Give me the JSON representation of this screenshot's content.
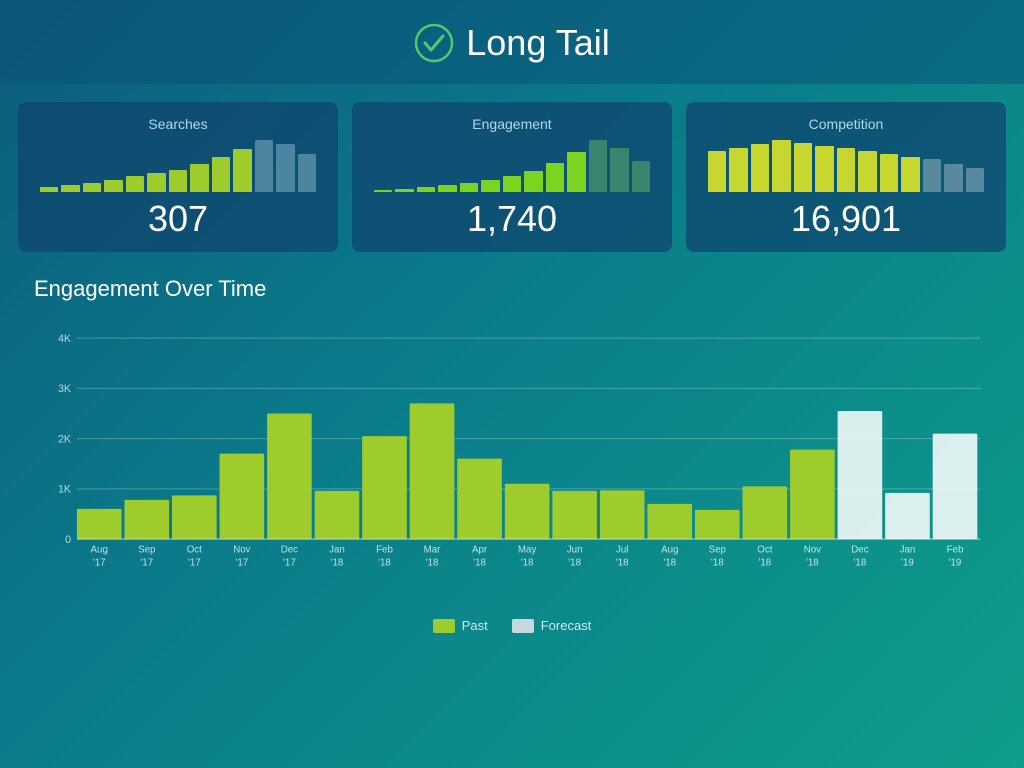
{
  "header": {
    "title": "Long Tail",
    "check_icon_label": "check-circle-icon"
  },
  "cards": [
    {
      "id": "searches",
      "label": "Searches",
      "value": "307",
      "bars": [
        3,
        4,
        5,
        7,
        9,
        11,
        13,
        16,
        20,
        25,
        30,
        28,
        22
      ],
      "bar_color_main": "#9dcc2c",
      "bar_color_forecast": "#6a9bb5"
    },
    {
      "id": "engagement",
      "label": "Engagement",
      "value": "1,740",
      "bars": [
        2,
        3,
        5,
        7,
        9,
        12,
        15,
        20,
        28,
        38,
        50,
        42,
        30
      ],
      "bar_color_main": "#7dd420",
      "bar_color_forecast": "#4e9b6a"
    },
    {
      "id": "competition",
      "label": "Competition",
      "value": "16,901",
      "bars": [
        30,
        32,
        35,
        38,
        36,
        34,
        32,
        30,
        28,
        26,
        24,
        20,
        18
      ],
      "bar_color_main": "#c8d630",
      "bar_color_forecast": "#7a9fb0"
    }
  ],
  "chart": {
    "title": "Engagement Over Time",
    "y_labels": [
      "4K",
      "3K",
      "2K",
      "1K",
      "0"
    ],
    "x_labels": [
      "Aug\n'17",
      "Sep\n'17",
      "Oct\n'17",
      "Nov\n'17",
      "Dec\n'17",
      "Jan\n'18",
      "Feb\n'18",
      "Mar\n'18",
      "Apr\n'18",
      "May\n'18",
      "Jun\n'18",
      "Jul\n'18",
      "Aug\n'18",
      "Sep\n'18",
      "Oct\n'18",
      "Nov\n'18",
      "Dec\n'18",
      "Jan\n'19",
      "Feb\n'19"
    ],
    "bars": [
      {
        "month": "Aug '17",
        "value": 600,
        "forecast": false
      },
      {
        "month": "Sep '17",
        "value": 780,
        "forecast": false
      },
      {
        "month": "Oct '17",
        "value": 870,
        "forecast": false
      },
      {
        "month": "Nov '17",
        "value": 1700,
        "forecast": false
      },
      {
        "month": "Dec '17",
        "value": 2500,
        "forecast": false
      },
      {
        "month": "Jan '18",
        "value": 960,
        "forecast": false
      },
      {
        "month": "Feb '18",
        "value": 2050,
        "forecast": false
      },
      {
        "month": "Mar '18",
        "value": 2700,
        "forecast": false
      },
      {
        "month": "Apr '18",
        "value": 1600,
        "forecast": false
      },
      {
        "month": "May '18",
        "value": 1100,
        "forecast": false
      },
      {
        "month": "Jun '18",
        "value": 960,
        "forecast": false
      },
      {
        "month": "Jul '18",
        "value": 970,
        "forecast": false
      },
      {
        "month": "Aug '18",
        "value": 700,
        "forecast": false
      },
      {
        "month": "Sep '18",
        "value": 580,
        "forecast": false
      },
      {
        "month": "Oct '18",
        "value": 1050,
        "forecast": false
      },
      {
        "month": "Nov '18",
        "value": 1780,
        "forecast": false
      },
      {
        "month": "Dec '18",
        "value": 2550,
        "forecast": true
      },
      {
        "month": "Jan '19",
        "value": 920,
        "forecast": true
      },
      {
        "month": "Feb '19",
        "value": 2100,
        "forecast": true
      }
    ],
    "max_value": 4000,
    "past_color": "#9dcc2c",
    "forecast_color": "rgba(255,255,255,0.85)",
    "axis_color": "rgba(255,255,255,0.3)"
  },
  "legend": {
    "past_label": "Past",
    "forecast_label": "Forecast",
    "past_color": "#9dcc2c",
    "forecast_color": "#c8d8e0"
  }
}
